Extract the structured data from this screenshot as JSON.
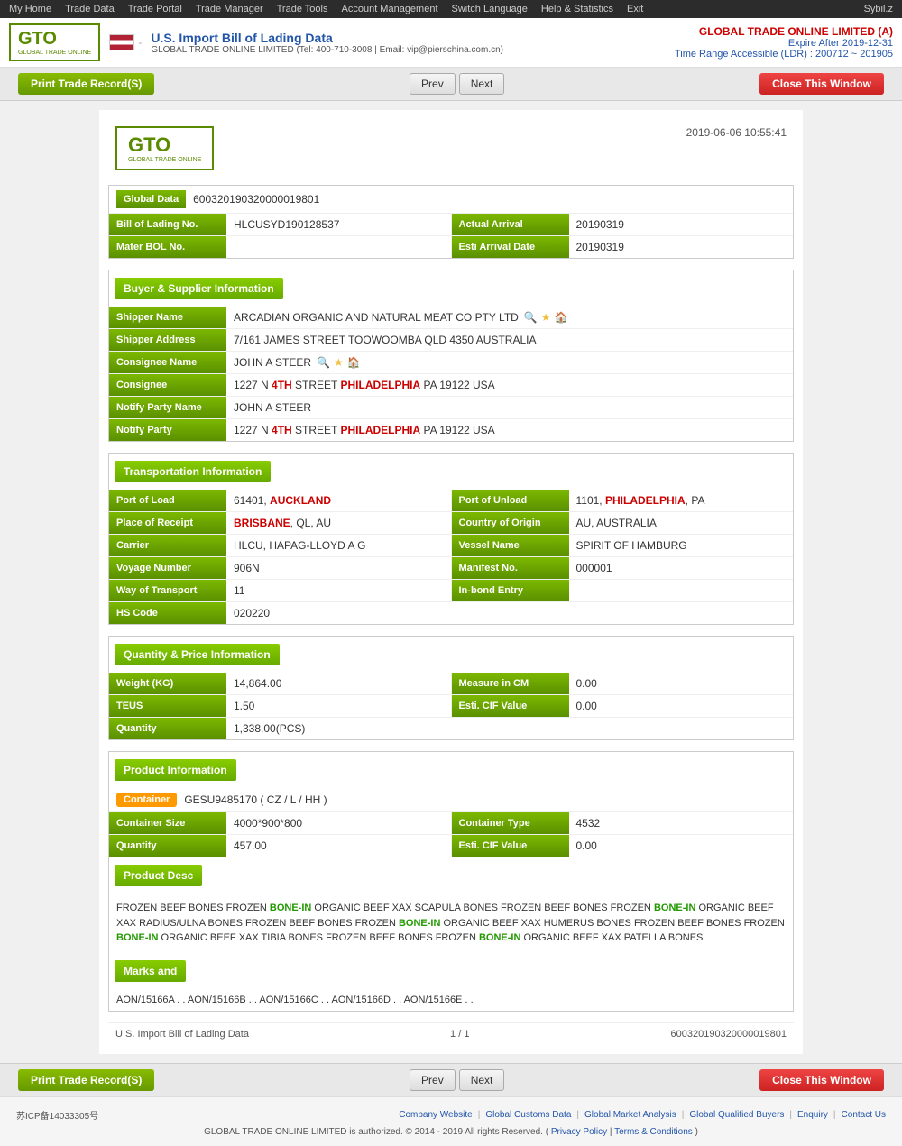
{
  "topnav": {
    "items": [
      "My Home",
      "Trade Data",
      "Trade Portal",
      "Trade Manager",
      "Trade Tools",
      "Account Management",
      "Switch Language",
      "Help & Statistics",
      "Exit"
    ],
    "user": "Sybil.z"
  },
  "header": {
    "logo": "GTO",
    "logo_sub": "GLOBAL TRADE ONLINE",
    "flag_country": "US",
    "title": "U.S. Import Bill of Lading Data",
    "company": "GLOBAL TRADE ONLINE LIMITED",
    "tel": "Tel: 400-710-3008",
    "email": "Email: vip@pierschina.com.cn",
    "account_company": "GLOBAL TRADE ONLINE LIMITED (A)",
    "expire_label": "Expire After 2019-12-31",
    "ldr_label": "Time Range Accessible (LDR) : 200712 ~ 201905"
  },
  "toolbar": {
    "print_label": "Print Trade Record(S)",
    "prev_label": "Prev",
    "next_label": "Next",
    "close_label": "Close This Window"
  },
  "document": {
    "datetime": "2019-06-06 10:55:41",
    "global_data_label": "Global Data",
    "global_data_value": "600320190320000019801",
    "bol_label": "Bill of Lading No.",
    "bol_value": "HLCUSYD190128537",
    "actual_arrival_label": "Actual Arrival",
    "actual_arrival_value": "20190319",
    "master_bol_label": "Mater BOL No.",
    "master_bol_value": "",
    "esti_arrival_label": "Esti Arrival Date",
    "esti_arrival_value": "20190319"
  },
  "buyer_supplier": {
    "section_label": "Buyer & Supplier Information",
    "shipper_name_label": "Shipper Name",
    "shipper_name_value": "ARCADIAN ORGANIC AND NATURAL MEAT CO PTY LTD",
    "shipper_address_label": "Shipper Address",
    "shipper_address_value": "7/161 JAMES STREET TOOWOOMBA QLD 4350 AUSTRALIA",
    "consignee_name_label": "Consignee Name",
    "consignee_name_value": "JOHN A STEER",
    "consignee_label": "Consignee",
    "consignee_value": "1227 N 4TH STREET PHILADELPHIA PA 19122 USA",
    "notify_party_name_label": "Notify Party Name",
    "notify_party_name_value": "JOHN A STEER",
    "notify_party_label": "Notify Party",
    "notify_party_value": "1227 N 4TH STREET PHILADELPHIA PA 19122 USA"
  },
  "transportation": {
    "section_label": "Transportation Information",
    "port_of_load_label": "Port of Load",
    "port_of_load_value": "61401, AUCKLAND",
    "port_of_unload_label": "Port of Unload",
    "port_of_unload_value": "1101, PHILADELPHIA, PA",
    "place_of_receipt_label": "Place of Receipt",
    "place_of_receipt_value": "BRISBANE, QL, AU",
    "country_of_origin_label": "Country of Origin",
    "country_of_origin_value": "AU, AUSTRALIA",
    "carrier_label": "Carrier",
    "carrier_value": "HLCU, HAPAG-LLOYD A G",
    "vessel_name_label": "Vessel Name",
    "vessel_name_value": "SPIRIT OF HAMBURG",
    "voyage_number_label": "Voyage Number",
    "voyage_number_value": "906N",
    "manifest_no_label": "Manifest No.",
    "manifest_no_value": "000001",
    "way_of_transport_label": "Way of Transport",
    "way_of_transport_value": "11",
    "in_bond_entry_label": "In-bond Entry",
    "in_bond_entry_value": "",
    "hs_code_label": "HS Code",
    "hs_code_value": "020220"
  },
  "quantity_price": {
    "section_label": "Quantity & Price Information",
    "weight_label": "Weight (KG)",
    "weight_value": "14,864.00",
    "measure_cm_label": "Measure in CM",
    "measure_cm_value": "0.00",
    "teus_label": "TEUS",
    "teus_value": "1.50",
    "esti_cif_label": "Esti. CIF Value",
    "esti_cif_value": "0.00",
    "quantity_label": "Quantity",
    "quantity_value": "1,338.00(PCS)"
  },
  "product_info": {
    "section_label": "Product Information",
    "container_badge": "Container",
    "container_value": "GESU9485170 ( CZ / L / HH )",
    "container_size_label": "Container Size",
    "container_size_value": "4000*900*800",
    "container_type_label": "Container Type",
    "container_type_value": "4532",
    "quantity_label": "Quantity",
    "quantity_value": "457.00",
    "esti_cif_label": "Esti. CIF Value",
    "esti_cif_value": "0.00",
    "product_desc_label": "Product Desc",
    "product_desc_value": "FROZEN BEEF BONES FROZEN BONE-IN ORGANIC BEEF XAX SCAPULA BONES FROZEN BEEF BONES FROZEN BONE-IN ORGANIC BEEF XAX RADIUS/ULNA BONES FROZEN BEEF BONES FROZEN BONE-IN ORGANIC BEEF XAX HUMERUS BONES FROZEN BEEF BONES FROZEN BONE-IN ORGANIC BEEF XAX TIBIA BONES FROZEN BEEF BONES FROZEN BONE-IN ORGANIC BEEF XAX PATELLA BONES",
    "marks_label": "Marks and",
    "marks_value": "AON/15166A . . AON/15166B . . AON/15166C . . AON/15166D . . AON/15166E . ."
  },
  "footer_doc": {
    "title": "U.S. Import Bill of Lading Data",
    "pagination": "1 / 1",
    "record_id": "600320190320000019801"
  },
  "site_footer": {
    "icp": "苏ICP备14033305号",
    "links": [
      "Company Website",
      "Global Customs Data",
      "Global Market Analysis",
      "Global Qualified Buyers",
      "Enquiry",
      "Contact Us"
    ],
    "copyright": "GLOBAL TRADE ONLINE LIMITED is authorized. © 2014 - 2019 All rights Reserved.",
    "policy_links": [
      "Privacy Policy",
      "Terms & Conditions"
    ]
  }
}
